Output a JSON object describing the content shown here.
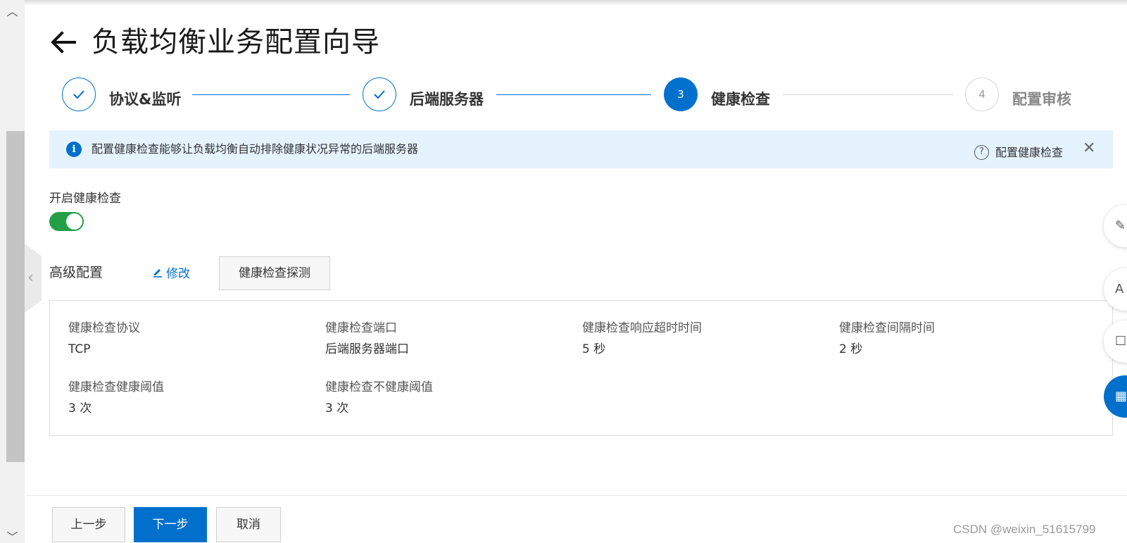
{
  "header": {
    "title": "负载均衡业务配置向导"
  },
  "stepper": {
    "steps": [
      {
        "number": "1",
        "label": "协议&监听",
        "status": "done"
      },
      {
        "number": "2",
        "label": "后端服务器",
        "status": "done"
      },
      {
        "number": "3",
        "label": "健康检查",
        "status": "active"
      },
      {
        "number": "4",
        "label": "配置审核",
        "status": "pending"
      }
    ]
  },
  "info_banner": {
    "text": "配置健康检查能够让负载均衡自动排除健康状况异常的后端服务器",
    "help_link": "配置健康检查",
    "help_icon": "?",
    "close_icon": "✕"
  },
  "health_check": {
    "toggle_label": "开启健康检查",
    "enabled": true
  },
  "advanced": {
    "title": "高级配置",
    "edit_label": "修改",
    "probe_button": "健康检查探测",
    "items": [
      {
        "label": "健康检查协议",
        "value": "TCP"
      },
      {
        "label": "健康检查端口",
        "value": "后端服务器端口"
      },
      {
        "label": "健康检查响应超时时间",
        "value": "5 秒"
      },
      {
        "label": "健康检查间隔时间",
        "value": "2 秒"
      },
      {
        "label": "健康检查健康阈值",
        "value": "3 次"
      },
      {
        "label": "健康检查不健康阈值",
        "value": "3 次"
      }
    ]
  },
  "footer": {
    "prev_label": "上一步",
    "next_label": "下一步",
    "cancel_label": "取消"
  },
  "watermark": "CSDN @weixin_51615799",
  "colors": {
    "primary": "#0070cc",
    "toggle_on": "#23a047",
    "banner_bg": "#e5f3ff"
  },
  "icons": {
    "back": "arrow-left-icon",
    "check": "check-icon",
    "info": "info-icon",
    "help": "question-circle-icon",
    "close": "close-icon",
    "edit": "pencil-icon"
  }
}
